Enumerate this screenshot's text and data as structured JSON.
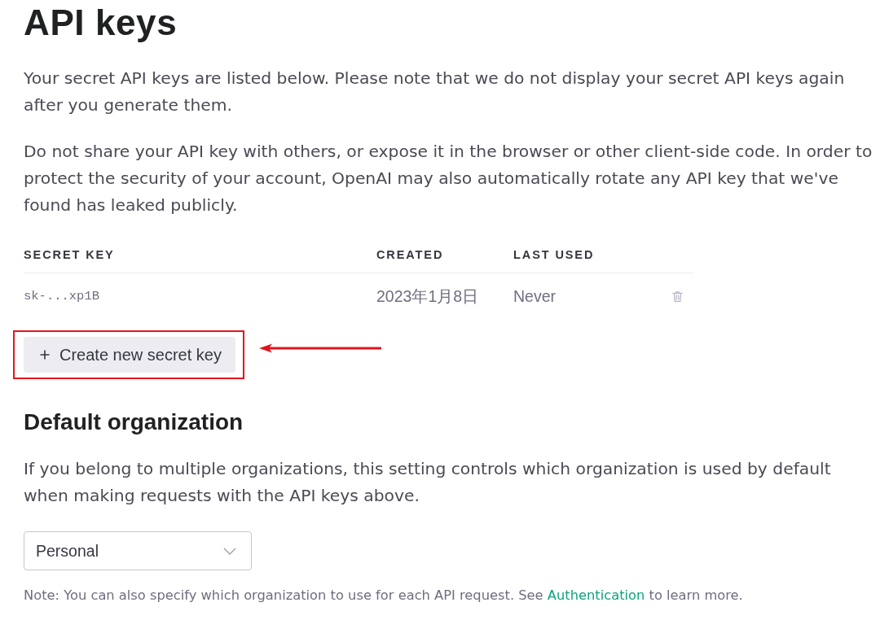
{
  "title": "API keys",
  "intro_paragraphs": [
    "Your secret API keys are listed below. Please note that we do not display your secret API keys again after you generate them.",
    "Do not share your API key with others, or expose it in the browser or other client-side code. In order to protect the security of your account, OpenAI may also automatically rotate any API key that we've found has leaked publicly."
  ],
  "keys_table": {
    "columns": [
      "SECRET KEY",
      "CREATED",
      "LAST USED"
    ],
    "rows": [
      {
        "secret_key": "sk-...xp1B",
        "created": "2023年1月8日",
        "last_used": "Never"
      }
    ]
  },
  "create_button": {
    "label": "Create new secret key",
    "highlighted": true
  },
  "default_organization": {
    "heading": "Default organization",
    "description": "If you belong to multiple organizations, this setting controls which organization is used by default when making requests with the API keys above.",
    "select": {
      "value": "Personal"
    },
    "note": {
      "text_before": "Note: You can also specify which organization to use for each API request. See",
      "link": "Authentication",
      "text_after": "to learn more."
    }
  }
}
